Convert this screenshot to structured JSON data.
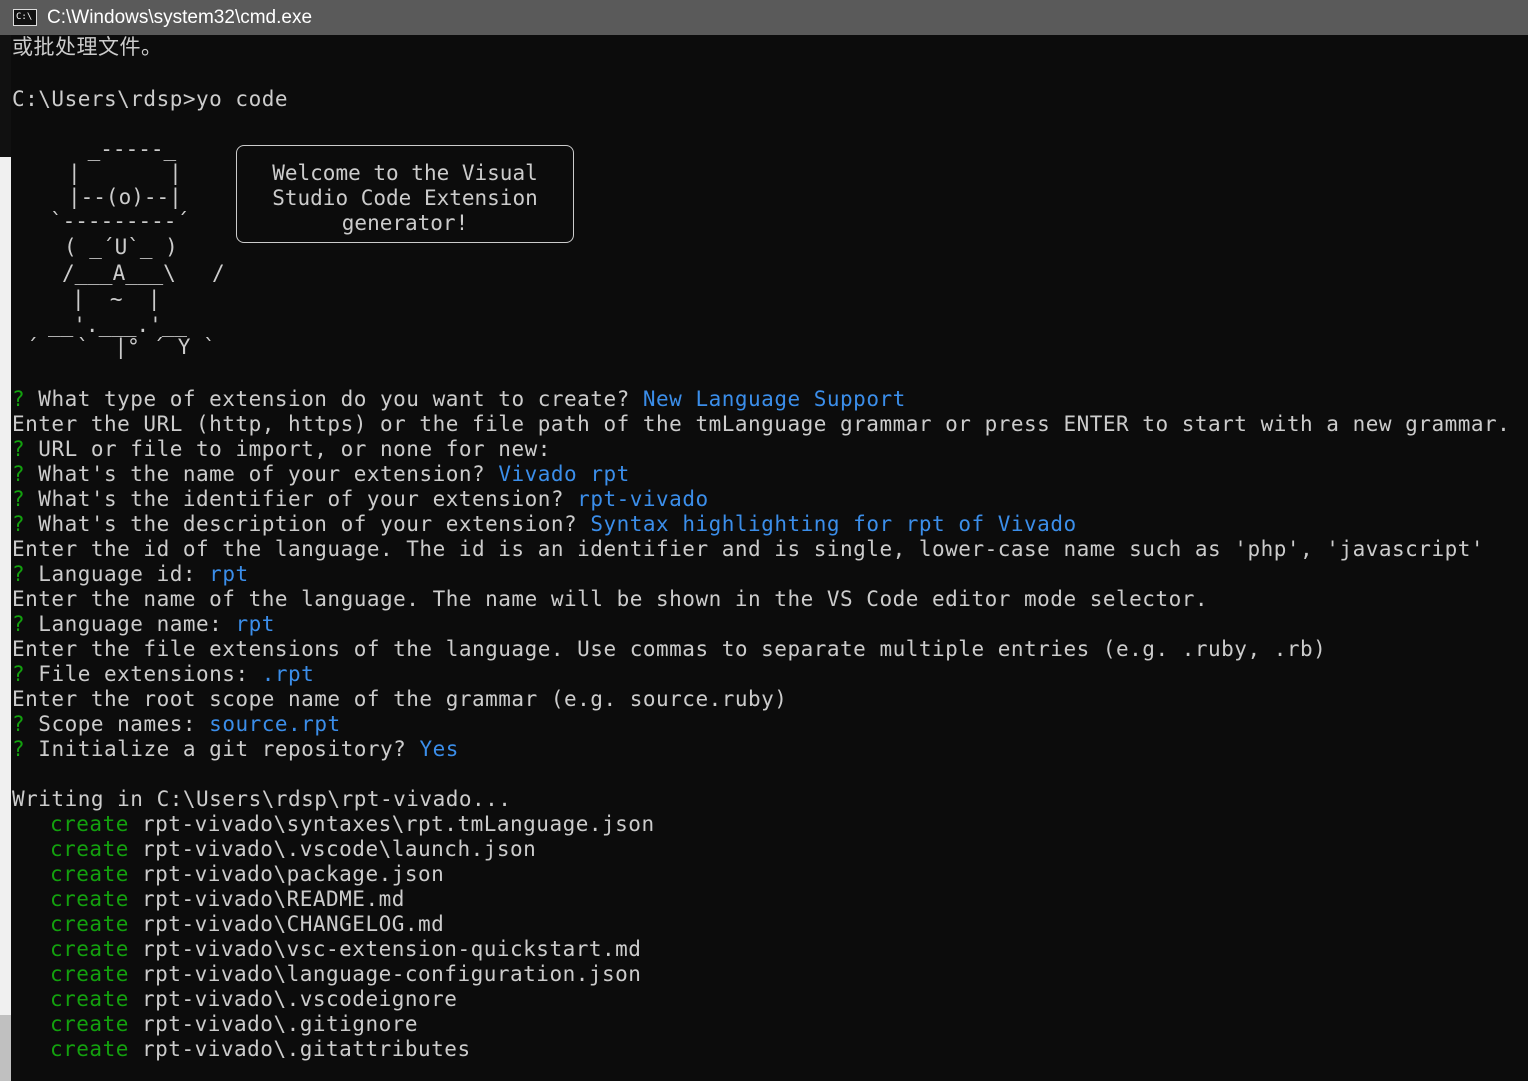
{
  "window": {
    "title": "C:\\Windows\\system32\\cmd.exe",
    "icon_text": "C:\\"
  },
  "console": {
    "line0": "或批处理文件。",
    "prompt": "C:\\Users\\rdsp>yo code",
    "yeoman": {
      "hat_top": " _-----_ ",
      "hat_row1": "|       |",
      "eye_row": "|--(o)--|",
      "brim": "`---------´",
      "face": "( _´U`_ )",
      "body1": "/___A___\\",
      "slash": "/",
      "legs": "|  ~  |",
      "feet": "__'.___.'__",
      "base": "´   `  |° ´ Y `",
      "bubble_text": "Welcome to the Visual\nStudio Code Extension\ngenerator!"
    },
    "qa": [
      {
        "mark": "?",
        "q": " What type of extension do you want to create?",
        "a": " New Language Support"
      },
      {
        "text": "Enter the URL (http, https) or the file path of the tmLanguage grammar or press ENTER to start with a new grammar."
      },
      {
        "mark": "?",
        "q": " URL or file to import, or none for new:",
        "a": ""
      },
      {
        "mark": "?",
        "q": " What's the name of your extension?",
        "a": " Vivado rpt"
      },
      {
        "mark": "?",
        "q": " What's the identifier of your extension?",
        "a": " rpt-vivado"
      },
      {
        "mark": "?",
        "q": " What's the description of your extension?",
        "a": " Syntax highlighting for rpt of Vivado"
      },
      {
        "text": "Enter the id of the language. The id is an identifier and is single, lower-case name such as 'php', 'javascript'"
      },
      {
        "mark": "?",
        "q": " Language id:",
        "a": " rpt"
      },
      {
        "text": "Enter the name of the language. The name will be shown in the VS Code editor mode selector."
      },
      {
        "mark": "?",
        "q": " Language name:",
        "a": " rpt"
      },
      {
        "text": "Enter the file extensions of the language. Use commas to separate multiple entries (e.g. .ruby, .rb)"
      },
      {
        "mark": "?",
        "q": " File extensions:",
        "a": " .rpt"
      },
      {
        "text": "Enter the root scope name of the grammar (e.g. source.ruby)"
      },
      {
        "mark": "?",
        "q": " Scope names:",
        "a": " source.rpt"
      },
      {
        "mark": "?",
        "q": " Initialize a git repository?",
        "a": " Yes"
      }
    ],
    "writing": "Writing in C:\\Users\\rdsp\\rpt-vivado...",
    "create_label": "create",
    "files": [
      "rpt-vivado\\syntaxes\\rpt.tmLanguage.json",
      "rpt-vivado\\.vscode\\launch.json",
      "rpt-vivado\\package.json",
      "rpt-vivado\\README.md",
      "rpt-vivado\\CHANGELOG.md",
      "rpt-vivado\\vsc-extension-quickstart.md",
      "rpt-vivado\\language-configuration.json",
      "rpt-vivado\\.vscodeignore",
      "rpt-vivado\\.gitignore",
      "rpt-vivado\\.gitattributes"
    ],
    "colors": {
      "question_mark": "#13a10e",
      "answer": "#3b8eea",
      "create": "#13a10e",
      "text": "#cccccc"
    }
  }
}
